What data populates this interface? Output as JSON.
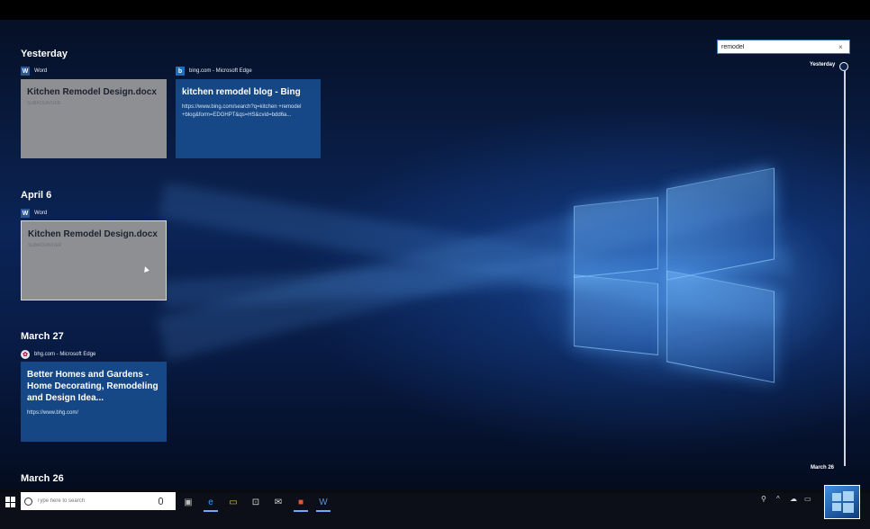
{
  "search": {
    "query": "remodel"
  },
  "timeline": {
    "top_label": "Yesterday",
    "bottom_label": "March 26"
  },
  "sections": [
    {
      "title": "Yesterday"
    },
    {
      "title": "April 6"
    },
    {
      "title": "March 27"
    },
    {
      "title": "March 26"
    }
  ],
  "cards": [
    {
      "app": "Word",
      "title": "Kitchen Remodel Design.docx",
      "sub": "SUBACEAVUER"
    },
    {
      "app": "bing.com - Microsoft Edge",
      "title": "kitchen remodel blog - Bing",
      "url": "https://www.bing.com/search?q=kitchen +remodel +blog&form=EDGHPT&qs=HS&cvid=bdd6a..."
    },
    {
      "app": "Word",
      "title": "Kitchen Remodel Design.docx",
      "sub": "SUBACEAVUER"
    },
    {
      "app": "bhg.com - Microsoft Edge",
      "title": "Better Homes and Gardens - Home Decorating, Remodeling and Design Idea...",
      "url": "https://www.bhg.com/"
    }
  ],
  "taskbar": {
    "search_placeholder": "Type here to search",
    "icons": [
      "task-view-icon",
      "edge-icon",
      "file-explorer-icon",
      "store-icon",
      "mail-icon",
      "office-icon",
      "word-icon"
    ]
  },
  "colors": {
    "accent": "#2b579a",
    "card_blue": "#174a8a",
    "card_gray": "#8d8f93"
  }
}
